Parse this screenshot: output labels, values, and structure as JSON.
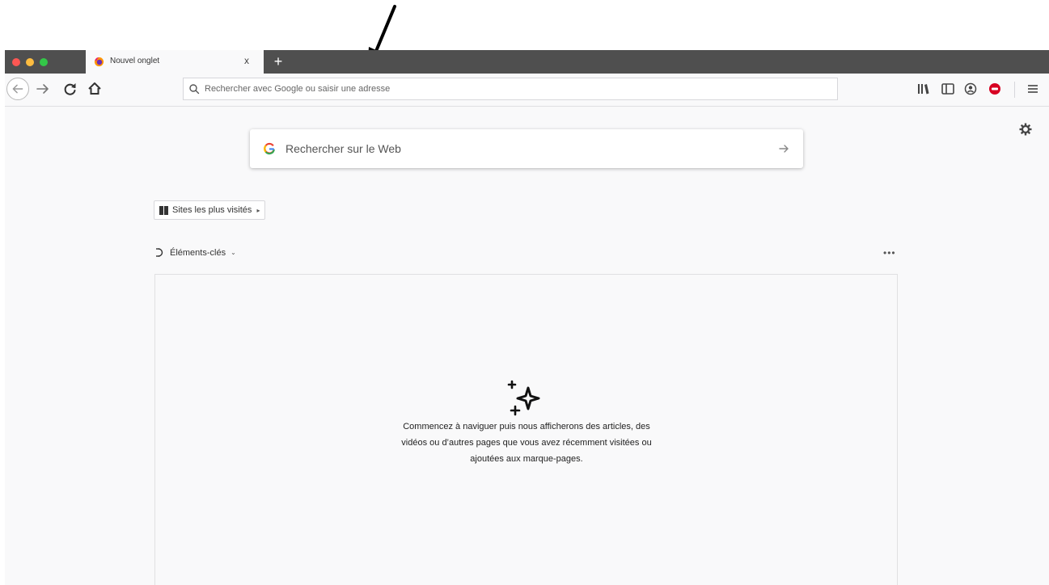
{
  "annotation": {
    "icon": "arrow-down-left-icon"
  },
  "window": {
    "traffic_lights": [
      "#fc5753",
      "#fdbc40",
      "#33c748"
    ],
    "tab": {
      "title": "Nouvel onglet",
      "close_label": "x",
      "favicon": "firefox-logo-icon"
    },
    "new_tab_label": "+"
  },
  "navbar": {
    "urlbar_placeholder": "Rechercher avec Google ou saisir une adresse",
    "icons": [
      "back-arrow-icon",
      "forward-arrow-icon",
      "reload-icon",
      "home-icon",
      "search-icon",
      "library-icon",
      "sidebar-icon",
      "account-icon",
      "addon-icon",
      "hamburger-menu-icon"
    ]
  },
  "newtab": {
    "search_label": "Rechercher sur le Web",
    "topsites_label": "Sites les plus visités",
    "topsites_caret": "▸",
    "highlights_label": "Éléments-clés",
    "highlights_caret": "⌄",
    "more_label": "•••",
    "empty_message": "Commencez à naviguer puis nous afficherons des articles, des vidéos ou d’autres pages que vous avez récemment visitées ou ajoutées aux marque-pages."
  }
}
